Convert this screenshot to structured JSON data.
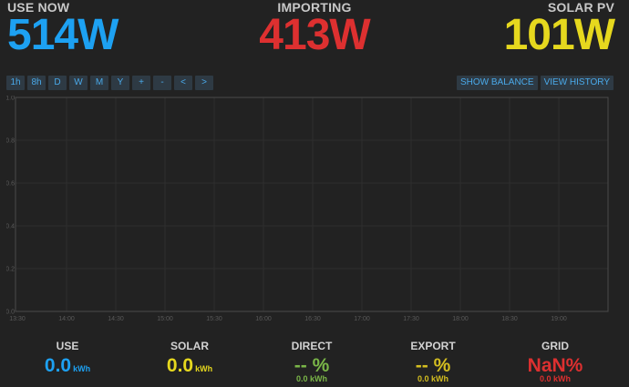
{
  "colors": {
    "background": "#222222",
    "use": "#1da1f2",
    "import": "#dd3030",
    "solar": "#e6d81e",
    "direct": "#7ab648",
    "export": "#d4be20",
    "grid": "#dd3030",
    "button_bg": "#2e3a44",
    "button_text": "#4aa9e9"
  },
  "header": {
    "use": {
      "label": "USE NOW",
      "value": "514W"
    },
    "import": {
      "label": "IMPORTING",
      "value": "413W"
    },
    "solar": {
      "label": "SOLAR PV",
      "value": "101W"
    }
  },
  "toolbar": {
    "buttons": [
      "1h",
      "8h",
      "D",
      "W",
      "M",
      "Y",
      "+",
      "-",
      "<",
      ">"
    ],
    "show_balance": "SHOW BALANCE",
    "view_history": "VIEW HISTORY"
  },
  "chart_data": {
    "type": "line",
    "series": [],
    "x_ticks": [
      "13:30",
      "14:00",
      "14:30",
      "15:00",
      "15:30",
      "16:00",
      "16:30",
      "17:00",
      "17:30",
      "18:00",
      "18:30",
      "19:00"
    ],
    "y_ticks": [
      "0.0",
      "0.2",
      "0.4",
      "0.6",
      "0.8",
      "1.0"
    ],
    "ylim": [
      0,
      1
    ],
    "grid": true
  },
  "summary": {
    "use": {
      "label": "USE",
      "value": "0.0",
      "unit": "kWh"
    },
    "solar": {
      "label": "SOLAR",
      "value": "0.0",
      "unit": "kWh"
    },
    "direct": {
      "label": "DIRECT",
      "value": "-- %",
      "sub": "0.0 kWh"
    },
    "export": {
      "label": "EXPORT",
      "value": "-- %",
      "sub": "0.0 kWh"
    },
    "grid": {
      "label": "GRID",
      "value": "NaN%",
      "sub": "0.0 kWh"
    }
  }
}
